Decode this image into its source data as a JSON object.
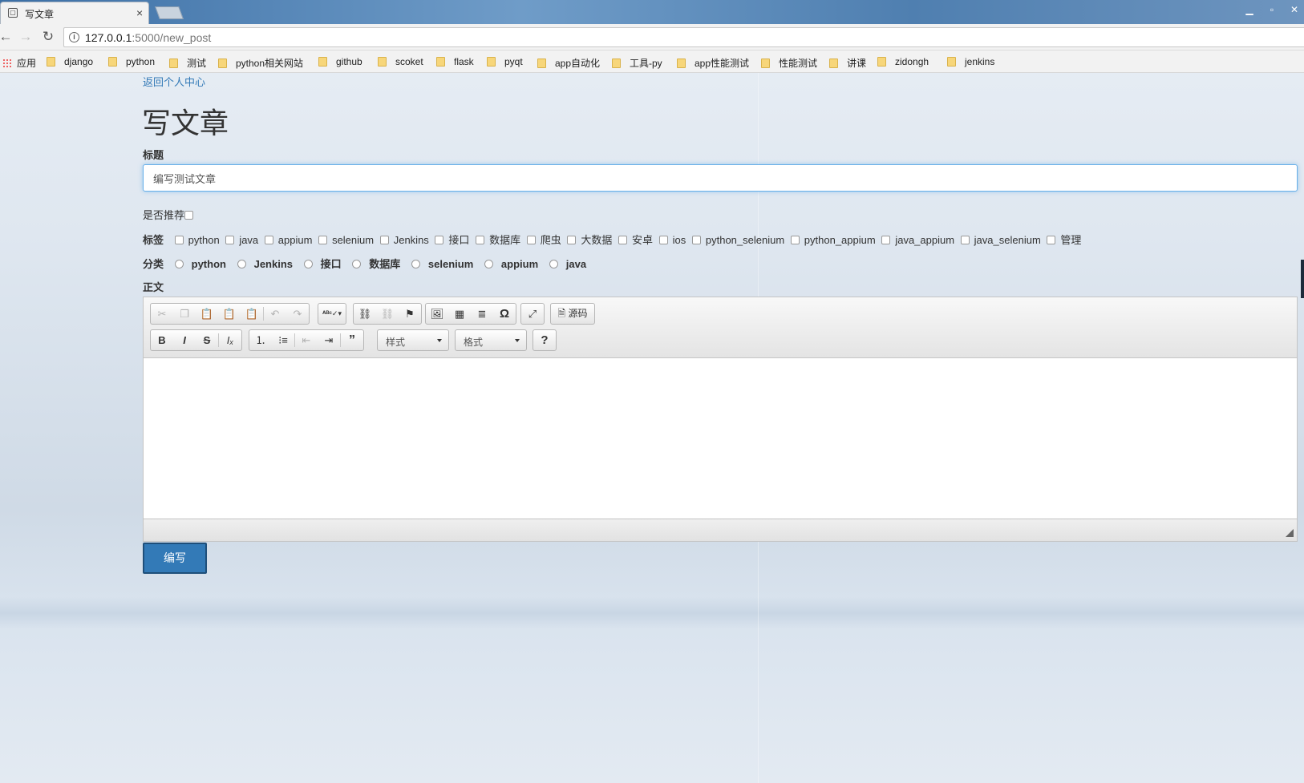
{
  "browser": {
    "tab_title": "写文章",
    "tab_close": "×",
    "url_host": "127.0.0.1",
    "url_rest": ":5000/new_post",
    "apps_label": "应用",
    "bookmarks": [
      "django",
      "python",
      "测试",
      "python相关网站",
      "github",
      "scoket",
      "flask",
      "pyqt",
      "app自动化",
      "工具-py",
      "app性能测试",
      "性能测试",
      "讲课",
      "zidongh",
      "jenkins"
    ]
  },
  "page": {
    "back_link": "返回个人中心",
    "title": "写文章",
    "title_label": "标题",
    "title_value": "编写测试文章",
    "recommend_label": "是否推荐",
    "tags_label": "标签",
    "tags": [
      "python",
      "java",
      "appium",
      "selenium",
      "Jenkins",
      "接口",
      "数据库",
      "爬虫",
      "大数据",
      "安卓",
      "ios",
      "python_selenium",
      "python_appium",
      "java_appium",
      "java_selenium",
      "管理"
    ],
    "category_label": "分类",
    "categories": [
      "python",
      "Jenkins",
      "接口",
      "数据库",
      "selenium",
      "appium",
      "java"
    ],
    "body_label": "正文",
    "submit_label": "编写"
  },
  "editor": {
    "style_combo": "样式",
    "format_combo": "格式",
    "source_label": "源码",
    "icons": [
      "cut-icon",
      "copy-icon",
      "paste-icon",
      "paste-text-icon",
      "paste-word-icon",
      "undo-icon",
      "redo-icon",
      "spellcheck-icon",
      "link-icon",
      "unlink-icon",
      "anchor-icon",
      "image-icon",
      "table-icon",
      "horizontal-rule-icon",
      "special-char-icon",
      "maximize-icon",
      "source-icon",
      "bold-icon",
      "italic-icon",
      "strike-icon",
      "remove-format-icon",
      "numbered-list-icon",
      "bulleted-list-icon",
      "outdent-icon",
      "indent-icon",
      "blockquote-icon",
      "help-icon"
    ]
  }
}
